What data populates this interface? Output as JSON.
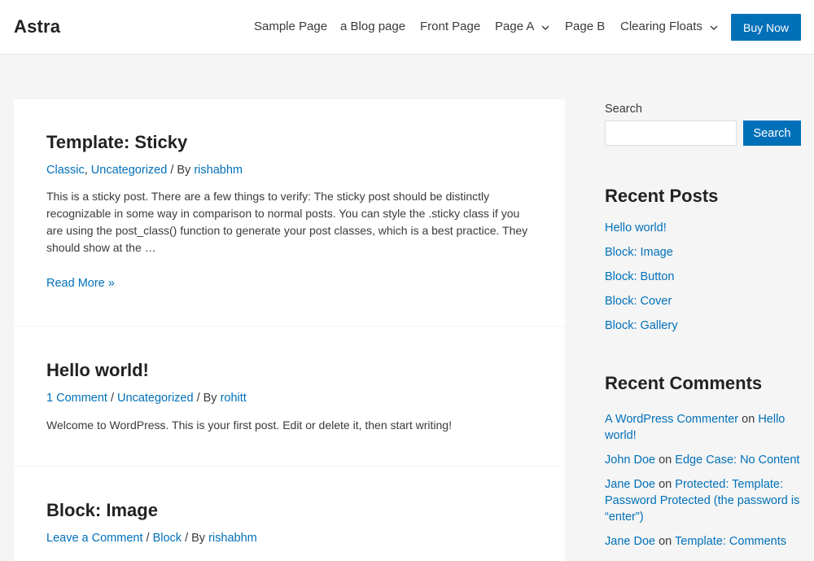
{
  "header": {
    "logo": "Astra",
    "nav": [
      {
        "label": "Sample Page",
        "has_dropdown": false
      },
      {
        "label": "a Blog page",
        "has_dropdown": false
      },
      {
        "label": "Front Page",
        "has_dropdown": false
      },
      {
        "label": "Page A",
        "has_dropdown": true
      },
      {
        "label": "Page B",
        "has_dropdown": false
      },
      {
        "label": "Clearing Floats",
        "has_dropdown": true
      }
    ],
    "cta_label": "Buy Now"
  },
  "posts": [
    {
      "title": "Template: Sticky",
      "meta": {
        "cat1": "Classic",
        "sep1": ", ",
        "cat2": "Uncategorized",
        "sep2": " / By ",
        "author": "rishabhm"
      },
      "excerpt": "This is a sticky post. There are a few things to verify: The sticky post should be distinctly recognizable in some way in comparison to normal posts. You can style the .sticky class if you are using the post_class() function to generate your post classes, which is a best practice. They should show at the …",
      "read_more": "Read More »"
    },
    {
      "title": "Hello world!",
      "meta": {
        "cat1": "1 Comment",
        "sep1": " / ",
        "cat2": "Uncategorized",
        "sep2": " / By ",
        "author": "rohitt"
      },
      "excerpt": "Welcome to WordPress. This is your first post. Edit or delete it, then start writing!"
    },
    {
      "title": "Block: Image",
      "meta": {
        "cat1": "Leave a Comment",
        "sep1": " / ",
        "cat2": "Block",
        "sep2": " / By ",
        "author": "rishabhm"
      }
    }
  ],
  "sidebar": {
    "search_label": "Search",
    "search_value": "",
    "search_button": "Search",
    "recent_posts_title": "Recent Posts",
    "recent_posts": [
      "Hello world!",
      "Block: Image",
      "Block: Button",
      "Block: Cover",
      "Block: Gallery"
    ],
    "recent_comments_title": "Recent Comments",
    "on_word": "on",
    "recent_comments": [
      {
        "author": "A WordPress Commenter",
        "post": "Hello world!"
      },
      {
        "author": "John Doe",
        "post": "Edge Case: No Content"
      },
      {
        "author": "Jane Doe",
        "post": "Protected: Template: Password Protected (the password is “enter”)"
      },
      {
        "author": "Jane Doe",
        "post": "Template: Comments"
      }
    ]
  },
  "colors": {
    "accent": "#0170b9",
    "page_bg": "#f5f5f5",
    "card_bg": "#ffffff",
    "text": "#3a3a3a",
    "heading": "#222222"
  }
}
